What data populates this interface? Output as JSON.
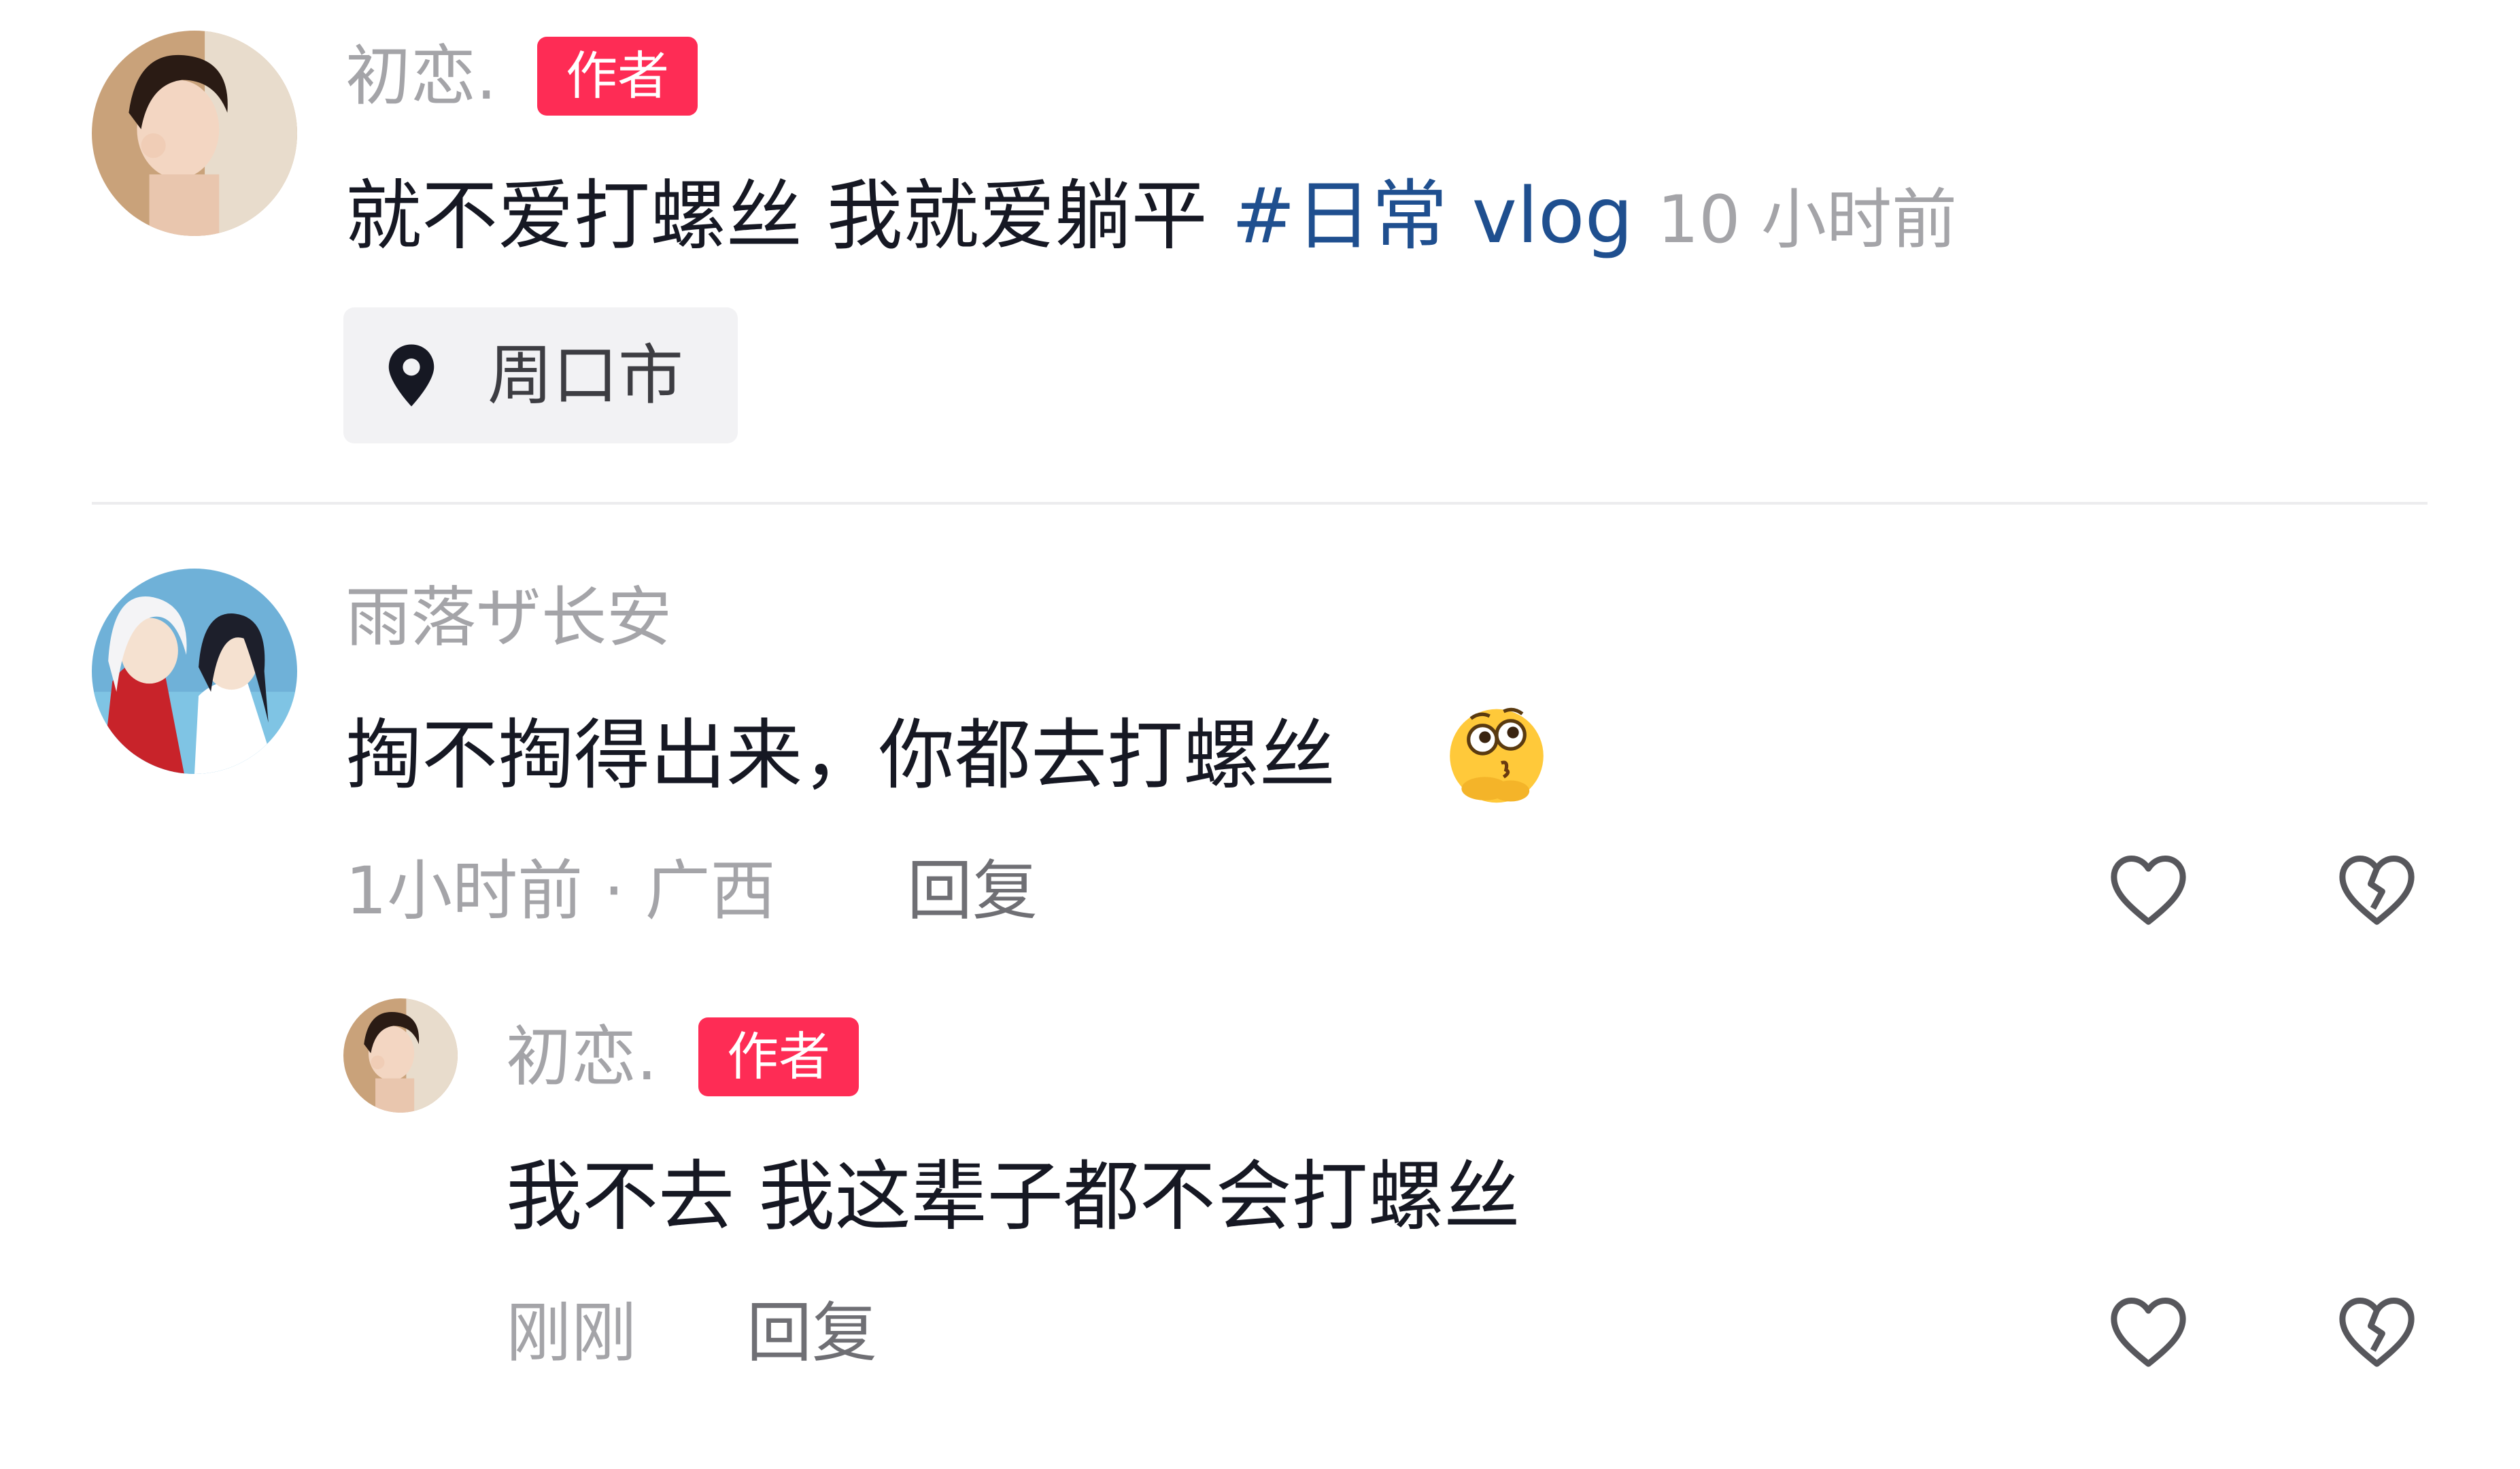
{
  "post": {
    "author_name": "初恋.",
    "author_badge": "作者",
    "text_main": "就不爱打螺丝 我就爱躺平",
    "hashtag": "#日常 vlog",
    "time": "10 小时前",
    "location": "周口市"
  },
  "comments": [
    {
      "user_name": "雨落ザ长安",
      "text": "掏不掏得出来，你都去打螺丝",
      "emoji": "thinking-face-icon",
      "meta": "1小时前 · 广西",
      "reply_label": "回复"
    }
  ],
  "replies": [
    {
      "user_name": "初恋.",
      "badge": "作者",
      "text": "我不去 我这辈子都不会打螺丝",
      "meta": "刚刚",
      "reply_label": "回复"
    }
  ],
  "colors": {
    "badge_bg": "#fe2c55",
    "hashtag": "#1f4f8f",
    "secondary_text": "#a4a4a8"
  }
}
